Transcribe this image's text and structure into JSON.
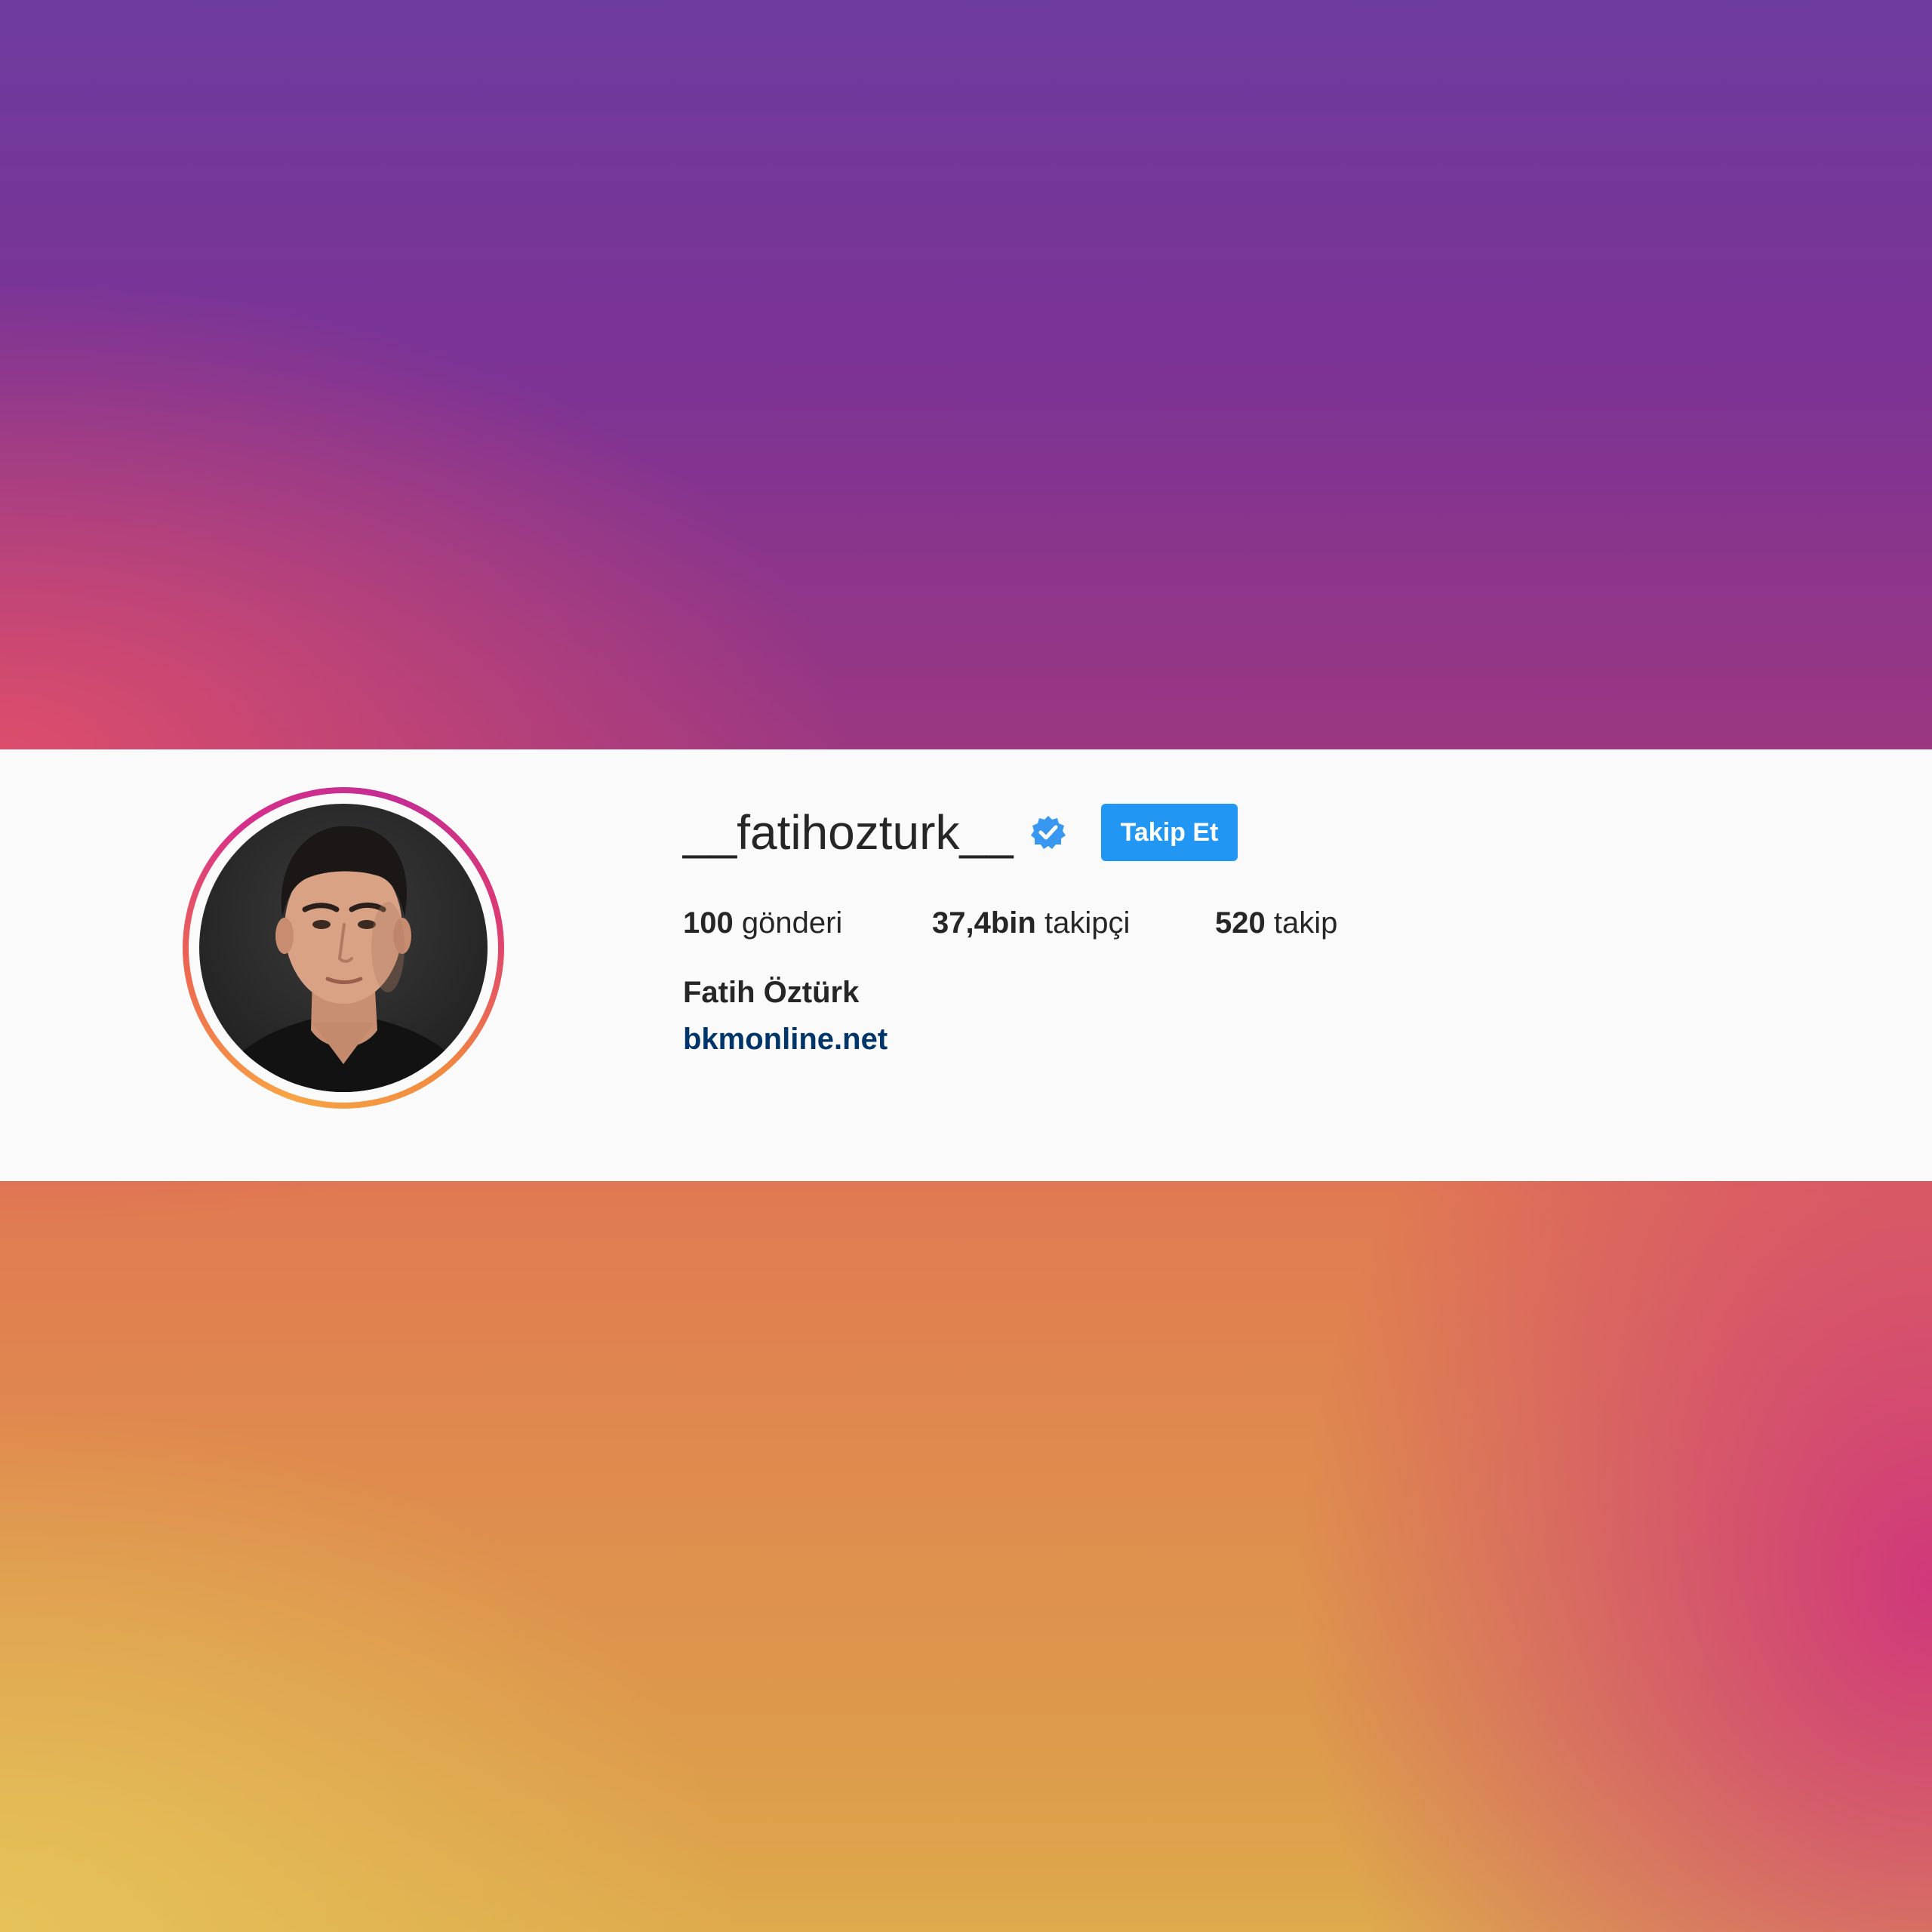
{
  "profile": {
    "username": "__fatihozturk__",
    "verified": true,
    "follow_label": "Takip Et",
    "full_name": "Fatih Öztürk",
    "website": "bkmonline.net",
    "stats": {
      "posts_count": "100",
      "posts_label": "gönderi",
      "followers_count": "37,4bin",
      "followers_label": "takipçi",
      "following_count": "520",
      "following_label": "takip"
    }
  },
  "icons": {
    "verified": "verified-badge-icon",
    "avatar": "profile-avatar"
  },
  "colors": {
    "accent": "#2196f3",
    "verified": "#3897f0",
    "link": "#003569",
    "text": "#262626",
    "card": "#fafafa"
  }
}
